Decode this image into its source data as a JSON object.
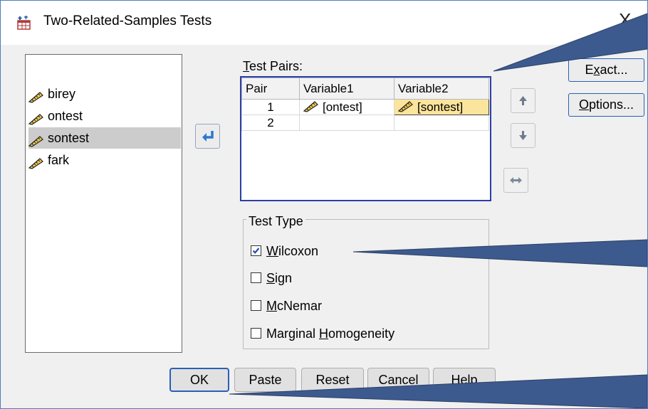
{
  "window": {
    "title": "Two-Related-Samples Tests",
    "close_glyph": "X"
  },
  "variables": [
    {
      "name": "birey",
      "selected": false
    },
    {
      "name": "ontest",
      "selected": false
    },
    {
      "name": "sontest",
      "selected": true
    },
    {
      "name": "fark",
      "selected": false
    }
  ],
  "test_pairs": {
    "label_first": "T",
    "label_rest": "est Pairs:",
    "columns": [
      "Pair",
      "Variable1",
      "Variable2"
    ],
    "rows": [
      {
        "pair": "1",
        "variable1": "[ontest]",
        "variable2": "[sontest]"
      },
      {
        "pair": "2",
        "variable1": "",
        "variable2": ""
      }
    ]
  },
  "buttons": {
    "exact_pre": "E",
    "exact_u": "x",
    "exact_post": "act...",
    "options_u": "O",
    "options_post": "ptions...",
    "ok": "OK",
    "paste": "Paste",
    "reset": "Reset",
    "cancel": "Cancel",
    "help": "Help"
  },
  "test_type": {
    "legend": "Test Type",
    "options": [
      {
        "u": "W",
        "rest": "ilcoxon",
        "checked": true
      },
      {
        "u": "S",
        "rest": "ign",
        "checked": false
      },
      {
        "u": "M",
        "rest": "cNemar",
        "checked": false
      },
      {
        "pre": "Marginal ",
        "u": "H",
        "rest": "omogeneity",
        "checked": false
      }
    ]
  },
  "colors": {
    "accent": "#2b5fb5",
    "callout": "#3d5a8f",
    "highlight": "#fbe59c"
  }
}
